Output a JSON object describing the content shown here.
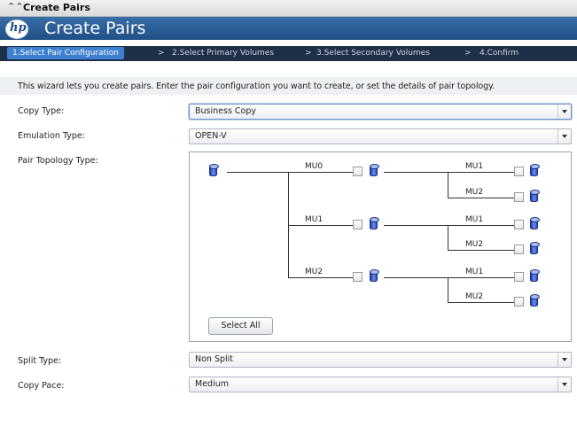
{
  "panel": {
    "title": "Create Pairs"
  },
  "header": {
    "logo_text": "hp",
    "title": "Create Pairs"
  },
  "steps": [
    "1.Select Pair Configuration",
    "2.Select Primary Volumes",
    "3.Select Secondary Volumes",
    "4.Confirm"
  ],
  "step_separator": ">",
  "intro": "This wizard lets you create pairs. Enter the pair configuration you want to create, or set the details of pair topology.",
  "fields": {
    "copy_type": {
      "label": "Copy Type:",
      "value": "Business Copy"
    },
    "emulation_type": {
      "label": "Emulation Type:",
      "value": "OPEN-V"
    },
    "pair_topology": {
      "label": "Pair Topology Type:"
    },
    "split_type": {
      "label": "Split Type:",
      "value": "Non Split"
    },
    "copy_pace": {
      "label": "Copy Pace:",
      "value": "Medium"
    }
  },
  "topology": {
    "level1": [
      "MU0",
      "MU1",
      "MU2"
    ],
    "level2": [
      "MU1",
      "MU2"
    ],
    "select_all": "Select All"
  },
  "icons": {
    "panel_toggle": "double-chevron-up-icon",
    "volume": "database-cylinder-icon",
    "dropdown": "chevron-down-icon"
  },
  "colors": {
    "header": "#1f4f86",
    "active_step": "#3d7fd1",
    "steps_bar": "#1f2f47",
    "volume": "#3b5fd6"
  }
}
